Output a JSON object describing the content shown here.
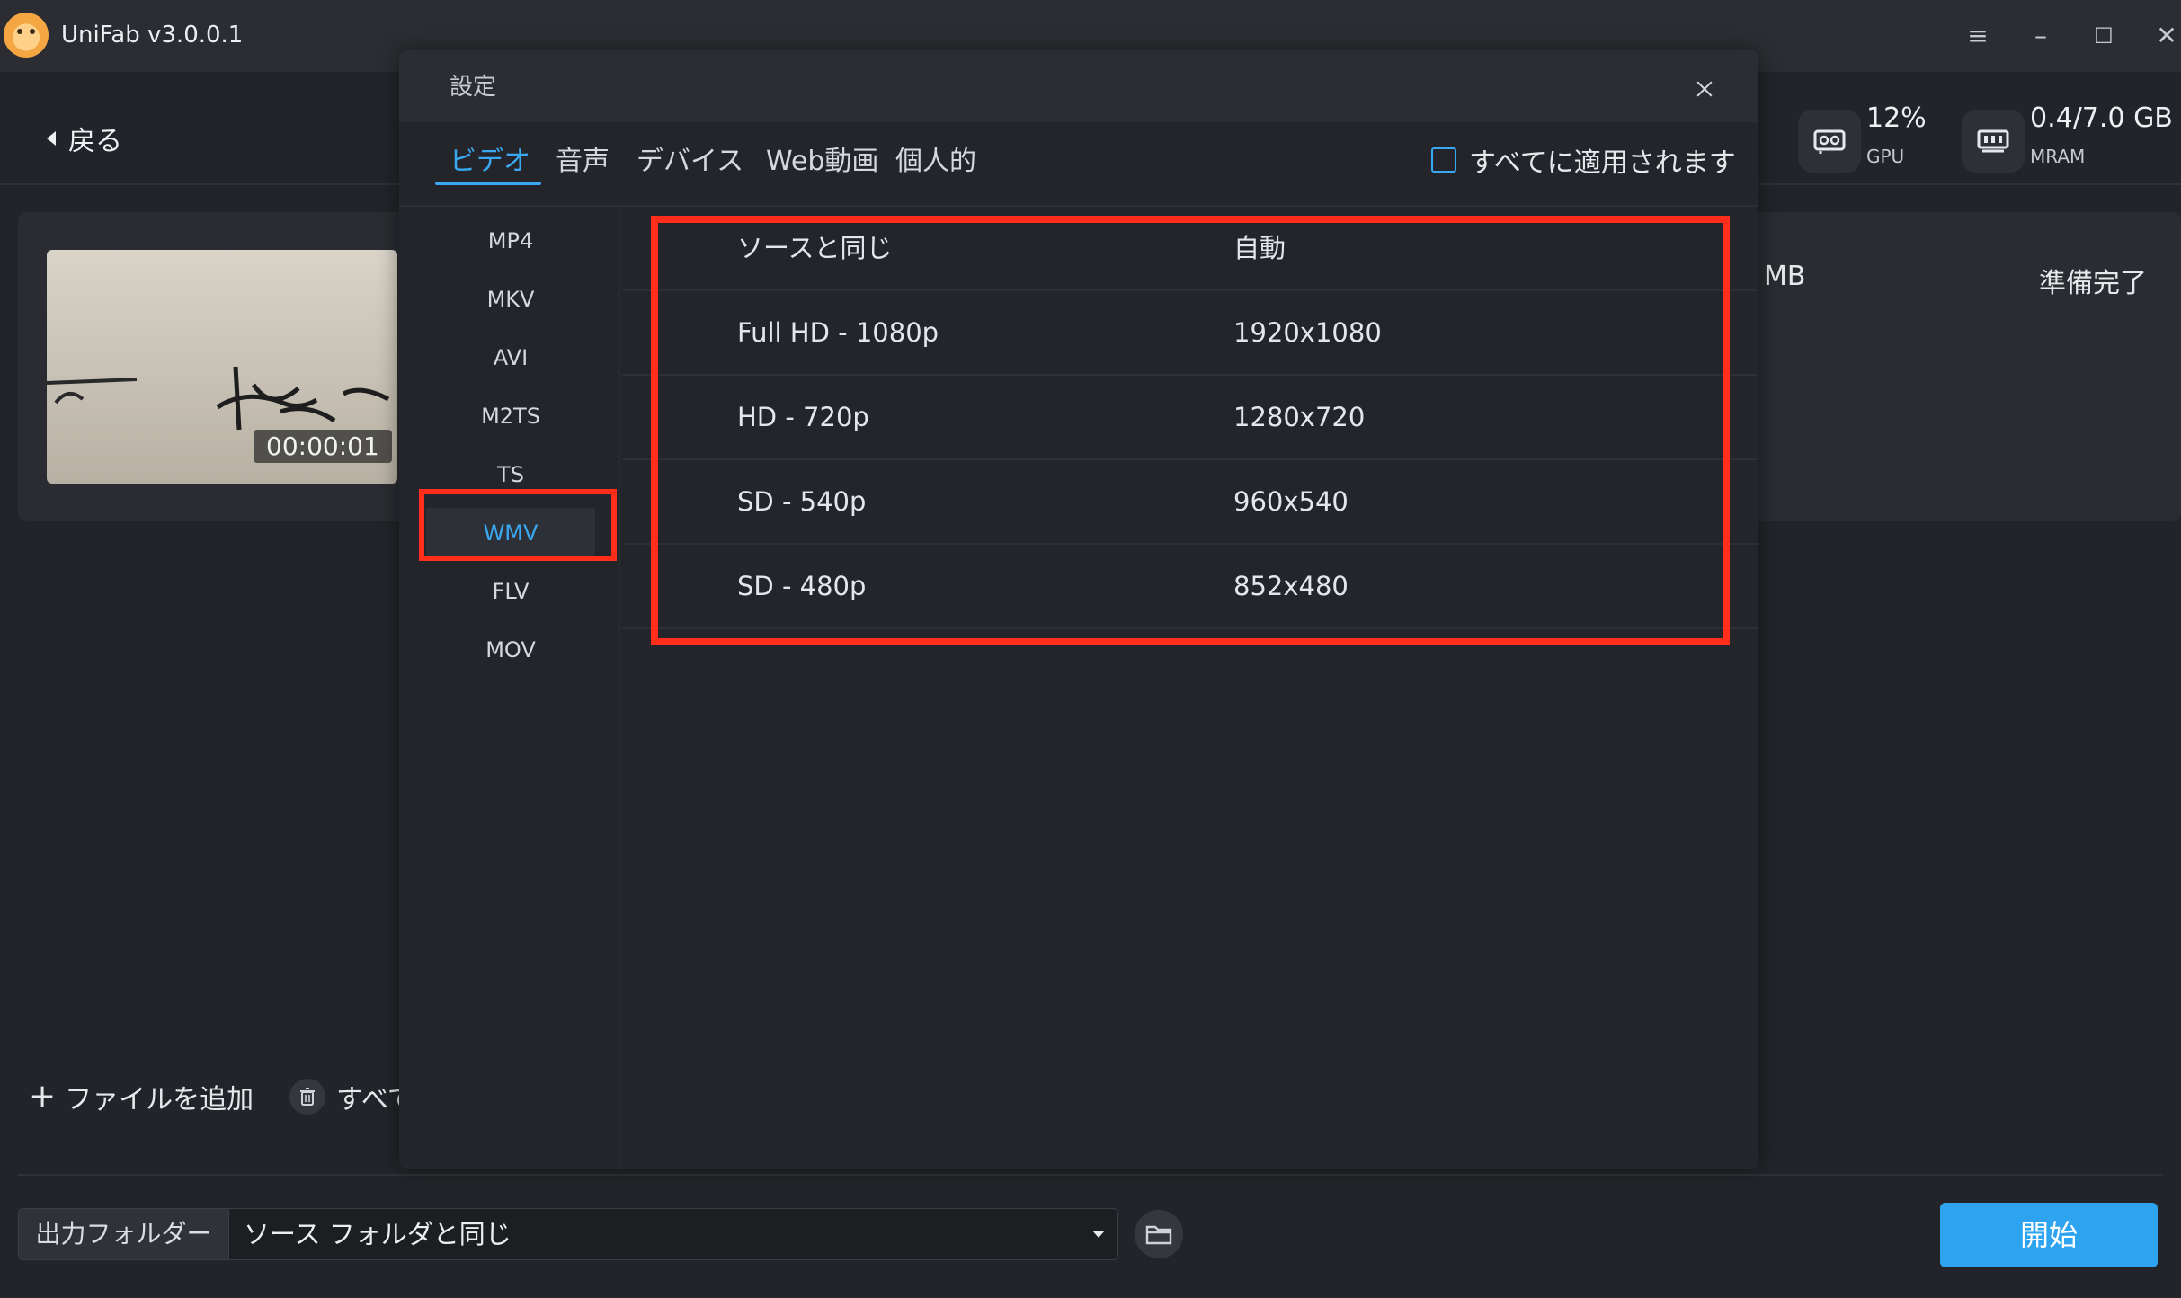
{
  "app": {
    "title": "UniFab v3.0.0.1"
  },
  "nav": {
    "back_label": "戻る"
  },
  "stats": {
    "gpu_value": "12%",
    "gpu_label": "GPU",
    "mram_value": "0.4/7.0 GB",
    "mram_label": "MRAM"
  },
  "file": {
    "duration": "00:00:01",
    "size": "MB",
    "status": "準備完了"
  },
  "actions": {
    "add_file": "ファイルを追加",
    "delete_all": "すべて"
  },
  "output": {
    "label": "出力フォルダー",
    "value": "ソース フォルダと同じ",
    "start": "開始"
  },
  "dialog": {
    "title": "設定",
    "tabs": [
      "ビデオ",
      "音声",
      "デバイス",
      "Web動画",
      "個人的"
    ],
    "active_tab": "ビデオ",
    "apply_all": "すべてに適用されます",
    "formats": [
      "MP4",
      "MKV",
      "AVI",
      "M2TS",
      "TS",
      "WMV",
      "FLV",
      "MOV"
    ],
    "selected_format": "WMV",
    "resolutions": [
      {
        "name": "ソースと同じ",
        "value": "自動"
      },
      {
        "name": "Full HD - 1080p",
        "value": "1920x1080"
      },
      {
        "name": "HD - 720p",
        "value": "1280x720"
      },
      {
        "name": "SD - 540p",
        "value": "960x540"
      },
      {
        "name": "SD - 480p",
        "value": "852x480"
      }
    ]
  },
  "colors": {
    "accent": "#3aa8f2",
    "highlight": "#ff2d1a",
    "start_button": "#2ea4f0"
  },
  "icons": [
    "app-logo",
    "menu-icon",
    "minimize-icon",
    "maximize-icon",
    "close-icon",
    "back-arrow-icon",
    "gpu-icon",
    "mram-icon",
    "plus-icon",
    "trash-icon",
    "folder-icon",
    "dropdown-arrow-icon"
  ]
}
